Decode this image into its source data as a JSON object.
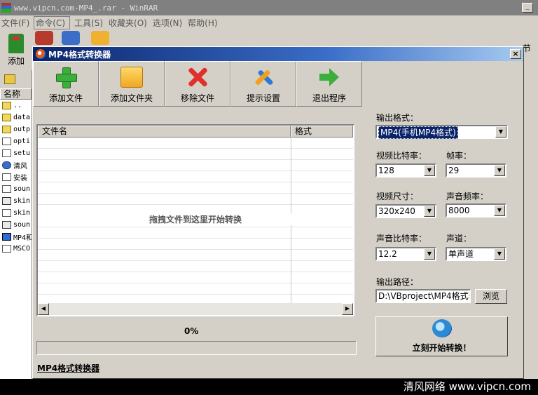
{
  "rar": {
    "title": "www.vipcn.com-MP4_.rar - WinRAR",
    "menu": [
      "文件(F)",
      "命令(C)",
      "工具(S)",
      "收藏夹(O)",
      "选项(N)",
      "帮助(H)"
    ],
    "add_label": "添加",
    "right_fragment": "节",
    "name_header": "名称",
    "files": [
      {
        "name": "..",
        "icon": "folder"
      },
      {
        "name": "data",
        "icon": "folder"
      },
      {
        "name": "outp",
        "icon": "folder"
      },
      {
        "name": "opti",
        "icon": "doc"
      },
      {
        "name": "setu",
        "icon": "doc"
      },
      {
        "name": "清风",
        "icon": "web"
      },
      {
        "name": "安装",
        "icon": "doc"
      },
      {
        "name": "soun",
        "icon": "doc"
      },
      {
        "name": "skin",
        "icon": "img"
      },
      {
        "name": "skin",
        "icon": "doc"
      },
      {
        "name": "soun",
        "icon": "img"
      },
      {
        "name": "MP4和",
        "icon": "app"
      },
      {
        "name": "MSCO",
        "icon": "doc"
      }
    ],
    "watermark": "清风网络 www.vipcn.com"
  },
  "dialog": {
    "title": "MP4格式转换器",
    "close": "×",
    "toolbar": [
      {
        "name": "add-file-button",
        "icon": "plus-icon",
        "label": "添加文件"
      },
      {
        "name": "add-folder-button",
        "icon": "folder-icon",
        "label": "添加文件夹"
      },
      {
        "name": "remove-file-button",
        "icon": "x-icon",
        "label": "移除文件"
      },
      {
        "name": "settings-tips-button",
        "icon": "tools-icon",
        "label": "提示设置"
      },
      {
        "name": "exit-button",
        "icon": "arrow-right-icon",
        "label": "退出程序"
      }
    ],
    "list": {
      "col_filename": "文件名",
      "col_format": "格式",
      "hint": "拖拽文件到这里开始转换"
    },
    "progress": {
      "text": "0%",
      "value": 0
    },
    "footer": "MP4格式转换器",
    "settings": {
      "output_format_label": "输出格式：",
      "output_format_value": "MP4(手机MP4格式)",
      "video_bitrate_label": "视频比特率：",
      "video_bitrate_value": "128",
      "framerate_label": "帧率：",
      "framerate_value": "29",
      "video_size_label": "视频尺寸：",
      "video_size_value": "320x240",
      "audio_freq_label": "声音频率：",
      "audio_freq_value": "8000",
      "audio_bitrate_label": "声音比特率：",
      "audio_bitrate_value": "12.2",
      "channel_label": "声道：",
      "channel_value": "单声道",
      "output_path_label": "输出路径：",
      "output_path_value": "D:\\VBproject\\MP4格式转",
      "browse_label": "浏览",
      "start_label": "立刻开始转换！"
    }
  }
}
